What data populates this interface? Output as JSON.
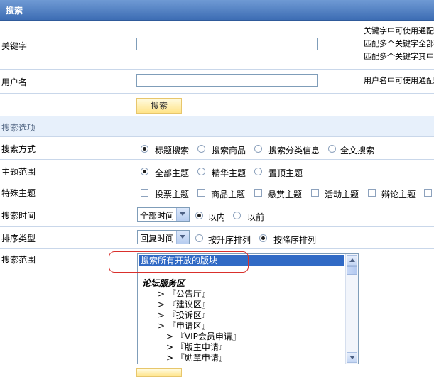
{
  "title": "搜索",
  "keyword": {
    "label": "关键字",
    "value": "",
    "hints": [
      "关键字中可使用通配",
      "匹配多个关键字全部",
      "匹配多个关键字其中"
    ]
  },
  "username": {
    "label": "用户名",
    "value": "",
    "hint": "用户名中可使用通配"
  },
  "search_button": "搜索",
  "section_title": "搜索选项",
  "search_mode": {
    "label": "搜索方式",
    "options": [
      "标题搜索",
      "搜索商品",
      "搜索分类信息",
      "全文搜索"
    ],
    "selected": "标题搜索"
  },
  "topic_scope": {
    "label": "主题范围",
    "options": [
      "全部主题",
      "精华主题",
      "置顶主题"
    ],
    "selected": "全部主题"
  },
  "special_topics": {
    "label": "特殊主题",
    "options": [
      "投票主题",
      "商品主题",
      "悬赏主题",
      "活动主题",
      "辩论主题"
    ]
  },
  "search_time": {
    "label": "搜索时间",
    "select_value": "全部时间",
    "options": [
      "以内",
      "以前"
    ],
    "selected": "以内"
  },
  "sort_type": {
    "label": "排序类型",
    "select_value": "回复时间",
    "options": [
      "按升序排列",
      "按降序排列"
    ],
    "selected": "按降序排列"
  },
  "search_range": {
    "label": "搜索范围",
    "selected_item": "搜索所有开放的版块",
    "group": "论坛服务区",
    "items": [
      {
        "text": "> 『公告厅』",
        "level": 1
      },
      {
        "text": "> 『建议区』",
        "level": 1
      },
      {
        "text": "> 『投诉区』",
        "level": 1
      },
      {
        "text": "> 『申请区』",
        "level": 1
      },
      {
        "text": "> 『VIP会员申请』",
        "level": 2
      },
      {
        "text": "> 『版主申请』",
        "level": 2
      },
      {
        "text": "> 『勋章申请』",
        "level": 2
      }
    ]
  },
  "colors": {
    "title_bar": "#3d6db4",
    "section_bg": "#e7f0fb",
    "selection": "#316ac5",
    "annotation": "#d9302c"
  }
}
